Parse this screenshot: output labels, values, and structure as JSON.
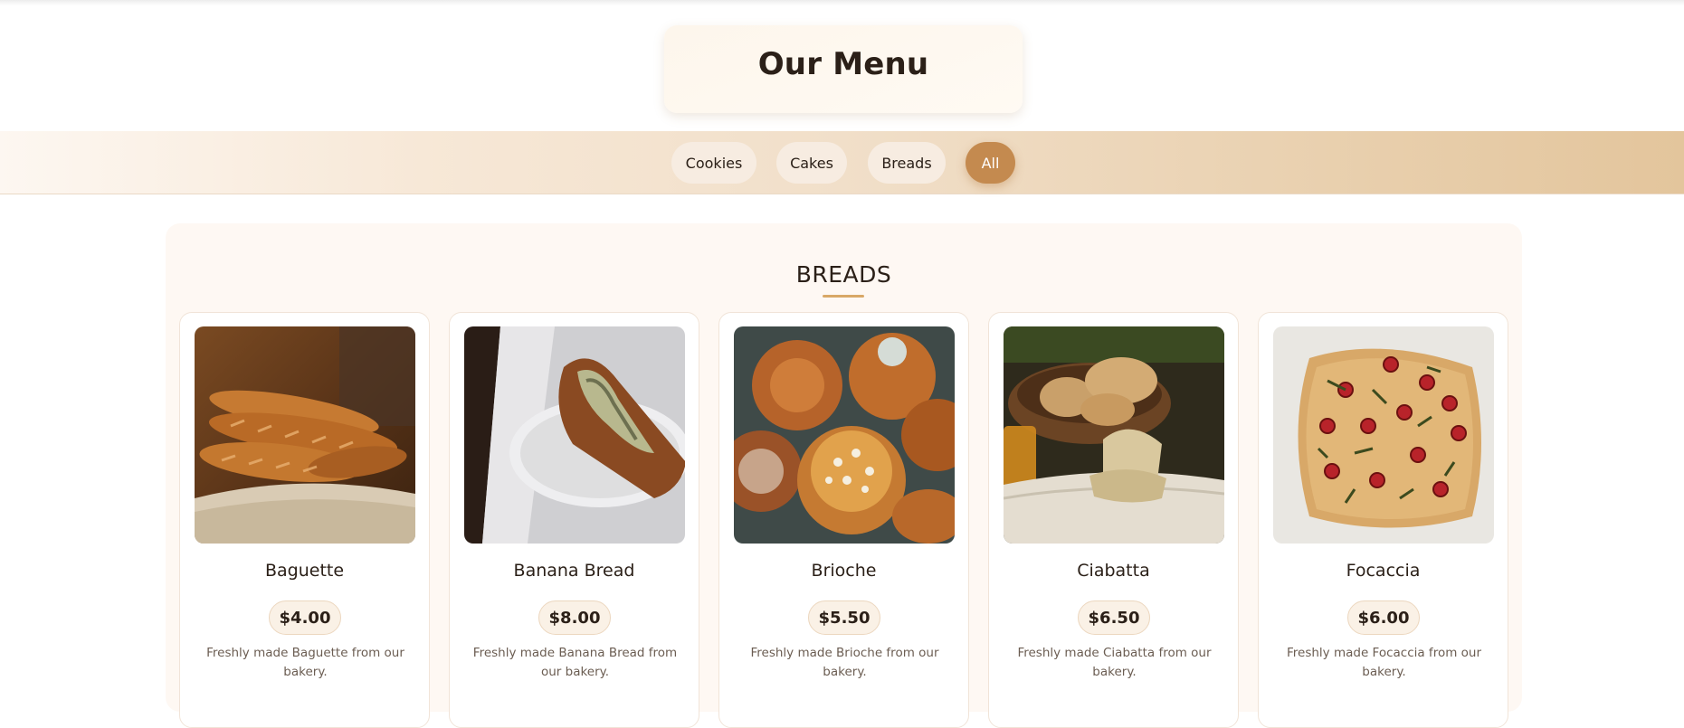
{
  "header": {
    "title": "Our Menu"
  },
  "tabs": [
    {
      "label": "Cookies",
      "active": false
    },
    {
      "label": "Cakes",
      "active": false
    },
    {
      "label": "Breads",
      "active": false
    },
    {
      "label": "All",
      "active": true
    }
  ],
  "section": {
    "title": "BREADS",
    "items": [
      {
        "name": "Baguette",
        "price": "$4.00",
        "description": "Freshly made Baguette from our bakery.",
        "image_icon": "baguette-photo"
      },
      {
        "name": "Banana Bread",
        "price": "$8.00",
        "description": "Freshly made Banana Bread from our bakery.",
        "image_icon": "banana-bread-photo"
      },
      {
        "name": "Brioche",
        "price": "$5.50",
        "description": "Freshly made Brioche from our bakery.",
        "image_icon": "brioche-photo"
      },
      {
        "name": "Ciabatta",
        "price": "$6.50",
        "description": "Freshly made Ciabatta from our bakery.",
        "image_icon": "ciabatta-photo"
      },
      {
        "name": "Focaccia",
        "price": "$6.00",
        "description": "Freshly made Focaccia from our bakery.",
        "image_icon": "focaccia-photo"
      }
    ]
  },
  "colors": {
    "accent": "#c48a4f",
    "underline": "#d9a867",
    "section_bg": "#fef8f3",
    "text": "#2b2018"
  }
}
